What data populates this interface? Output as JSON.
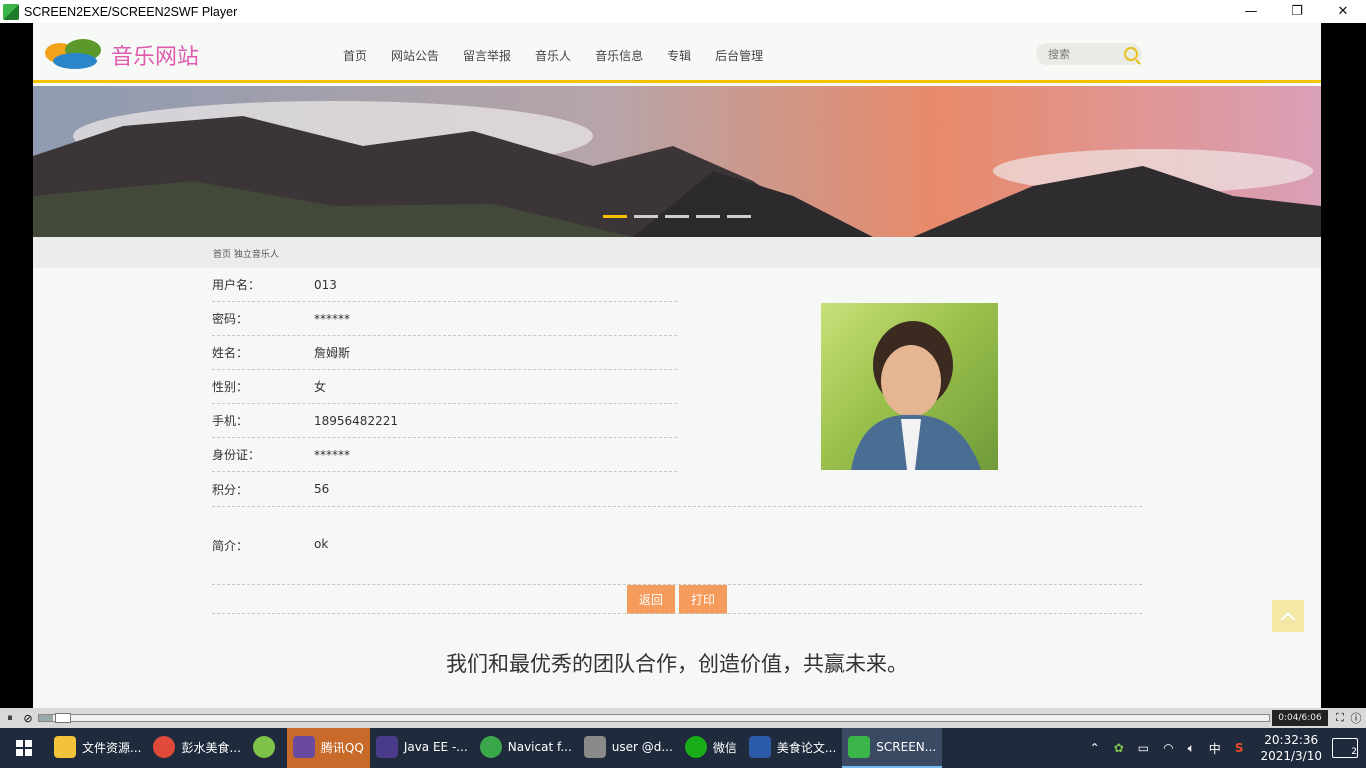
{
  "window": {
    "title": "SCREEN2EXE/SCREEN2SWF Player",
    "controls": [
      "—",
      "❐",
      "✕"
    ]
  },
  "site": {
    "logo_text": "音乐网站",
    "nav": [
      "首页",
      "网站公告",
      "留言举报",
      "音乐人",
      "音乐信息",
      "专辑",
      "后台管理"
    ],
    "search_placeholder": "搜索"
  },
  "breadcrumb": "首页 独立音乐人",
  "detail": {
    "rows": [
      {
        "label": "用户名：",
        "value": "013"
      },
      {
        "label": "密码：",
        "value": "******"
      },
      {
        "label": "姓名：",
        "value": "詹姆斯"
      },
      {
        "label": "性别：",
        "value": "女"
      },
      {
        "label": "手机：",
        "value": "18956482221"
      },
      {
        "label": "身份证：",
        "value": "******"
      },
      {
        "label": "积分：",
        "value": "56"
      }
    ],
    "intro_label": "简介：",
    "intro_value": "ok"
  },
  "buttons": {
    "back": "返回",
    "print": "打印"
  },
  "slogan": "我们和最优秀的团队合作，创造价值，共赢未来。",
  "player": {
    "time": "0:04/6:06",
    "progress": 0.011
  },
  "taskbar": {
    "items": [
      {
        "label": "文件资源...",
        "color": "#f3c33a"
      },
      {
        "label": "彭水美食...",
        "color": "#e04a3a"
      },
      {
        "label": "",
        "color": "#7fc24a"
      },
      {
        "label": "腾讯QQ",
        "color": "#6a4aa0"
      },
      {
        "label": "Java EE -...",
        "color": "#4a3a8a"
      },
      {
        "label": "Navicat f...",
        "color": "#3aa84a"
      },
      {
        "label": "user @d...",
        "color": "#8a8a8a"
      },
      {
        "label": "微信",
        "color": "#1aad19"
      },
      {
        "label": "美食论文...",
        "color": "#2b5aa8"
      },
      {
        "label": "SCREEN...",
        "color": "#3bb54a"
      }
    ],
    "ime": "中",
    "time": "20:32:36",
    "date": "2021/3/10",
    "notifications": "2"
  }
}
